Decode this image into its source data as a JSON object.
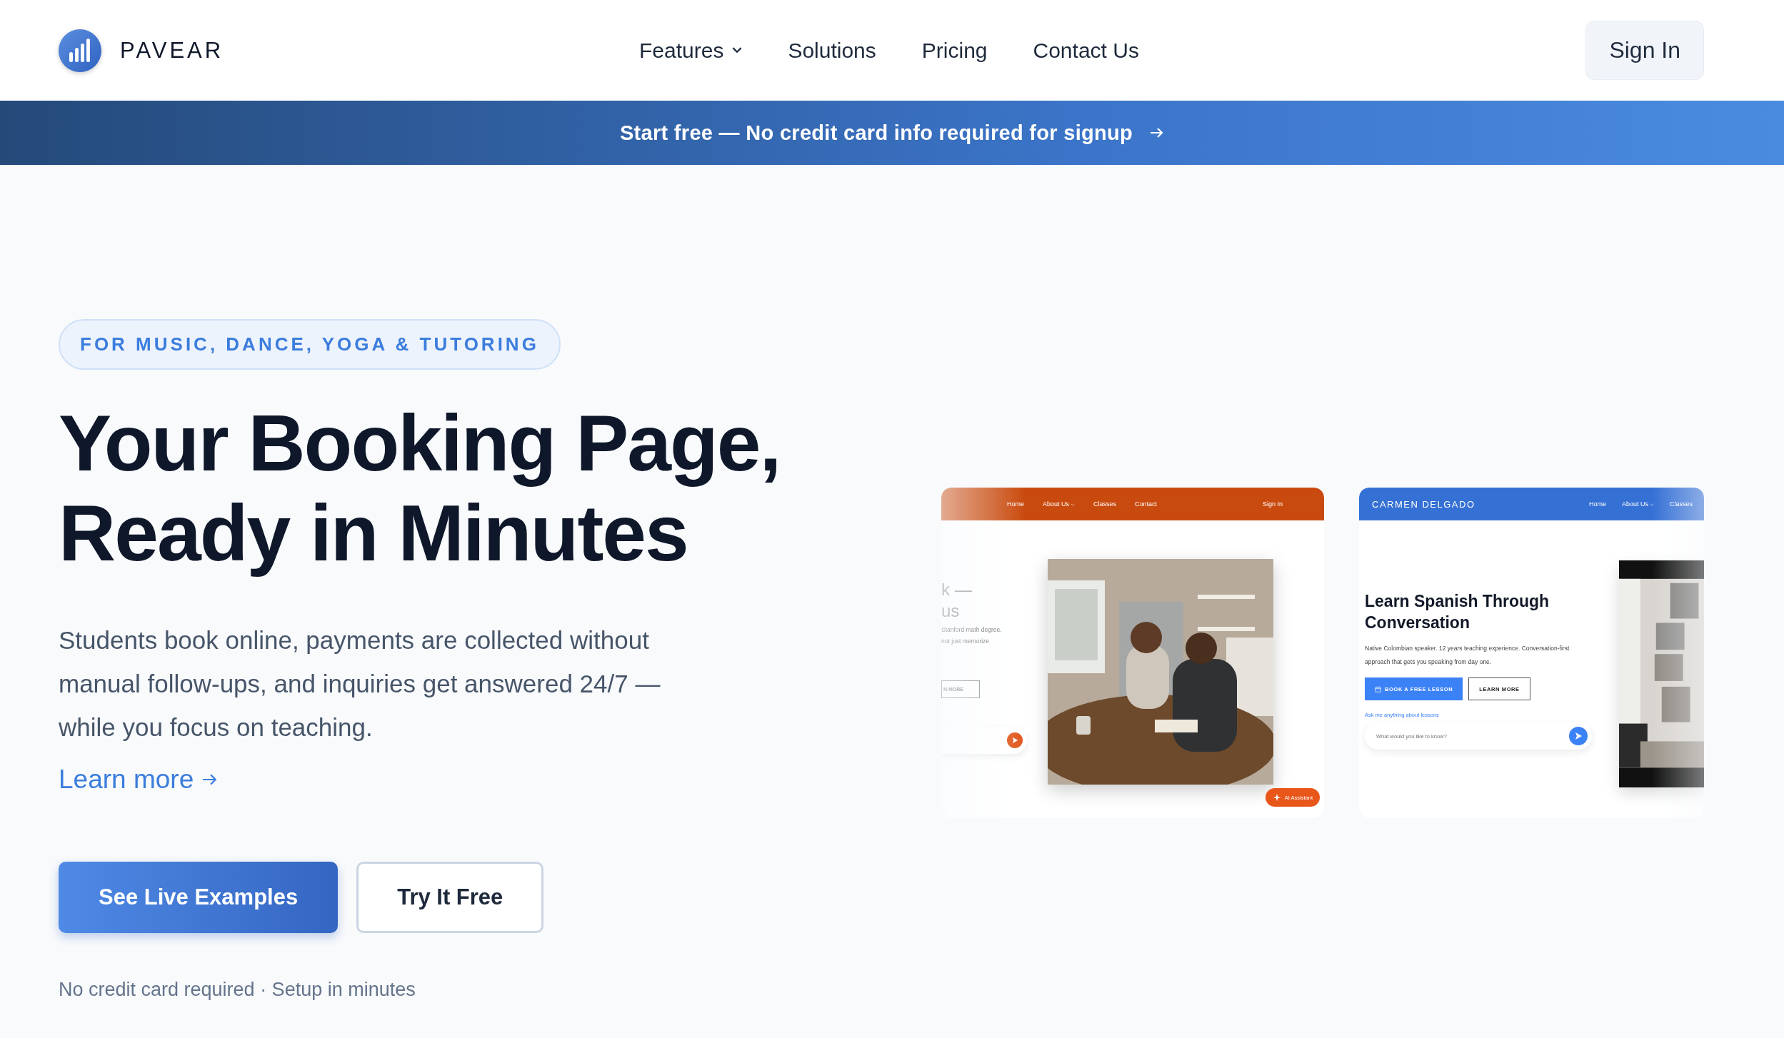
{
  "header": {
    "brand": "PAVEAR",
    "nav": [
      {
        "label": "Features",
        "kind": "dropdown"
      },
      {
        "label": "Solutions",
        "kind": "link"
      },
      {
        "label": "Pricing",
        "kind": "link"
      },
      {
        "label": "Contact Us",
        "kind": "link"
      }
    ],
    "sign_in": "Sign In"
  },
  "banner": {
    "text": "Start free — No credit card info required for signup"
  },
  "hero": {
    "badge": "FOR MUSIC, DANCE, YOGA & TUTORING",
    "headline": [
      "Your Booking Page,",
      "Ready in Minutes"
    ],
    "description": "Students book online, payments are collected without manual follow-ups, and inquiries get answered 24/7 — while you focus on teaching.",
    "learn_more": "Learn more",
    "buttons": [
      {
        "label": "See Live Examples",
        "kind": "primary"
      },
      {
        "label": "Try It Free",
        "kind": "outline"
      }
    ],
    "footnote": "No credit card required · Setup in minutes"
  },
  "preview_left": {
    "nav": [
      {
        "label": "Home",
        "kind": "link"
      },
      {
        "label": "About Us",
        "kind": "dropdown"
      },
      {
        "label": "Classes",
        "kind": "link"
      },
      {
        "label": "Contact",
        "kind": "link"
      }
    ],
    "sign_in": "Sign In",
    "heading_lines": [
      "k —",
      "us"
    ],
    "text_lines": [
      "Stanford math degree.",
      "not just memorize"
    ],
    "button": "N MORE",
    "assistant": "AI Assistant"
  },
  "preview_right": {
    "brand": "CARMEN DELGADO",
    "nav": [
      {
        "label": "Home",
        "kind": "link"
      },
      {
        "label": "About Us",
        "kind": "dropdown"
      },
      {
        "label": "Classes",
        "kind": "link"
      }
    ],
    "headline": "Learn Spanish Through Conversation",
    "description": "Native Colombian speaker. 12 years teaching experience. Conversation-first approach that gets you speaking from day one.",
    "buttons": [
      {
        "label": "BOOK A FREE LESSON",
        "kind": "primary"
      },
      {
        "label": "LEARN MORE",
        "kind": "outline"
      }
    ],
    "chat_label": "Ask me anything about lessons",
    "chat_placeholder": "What would you like to know?"
  }
}
